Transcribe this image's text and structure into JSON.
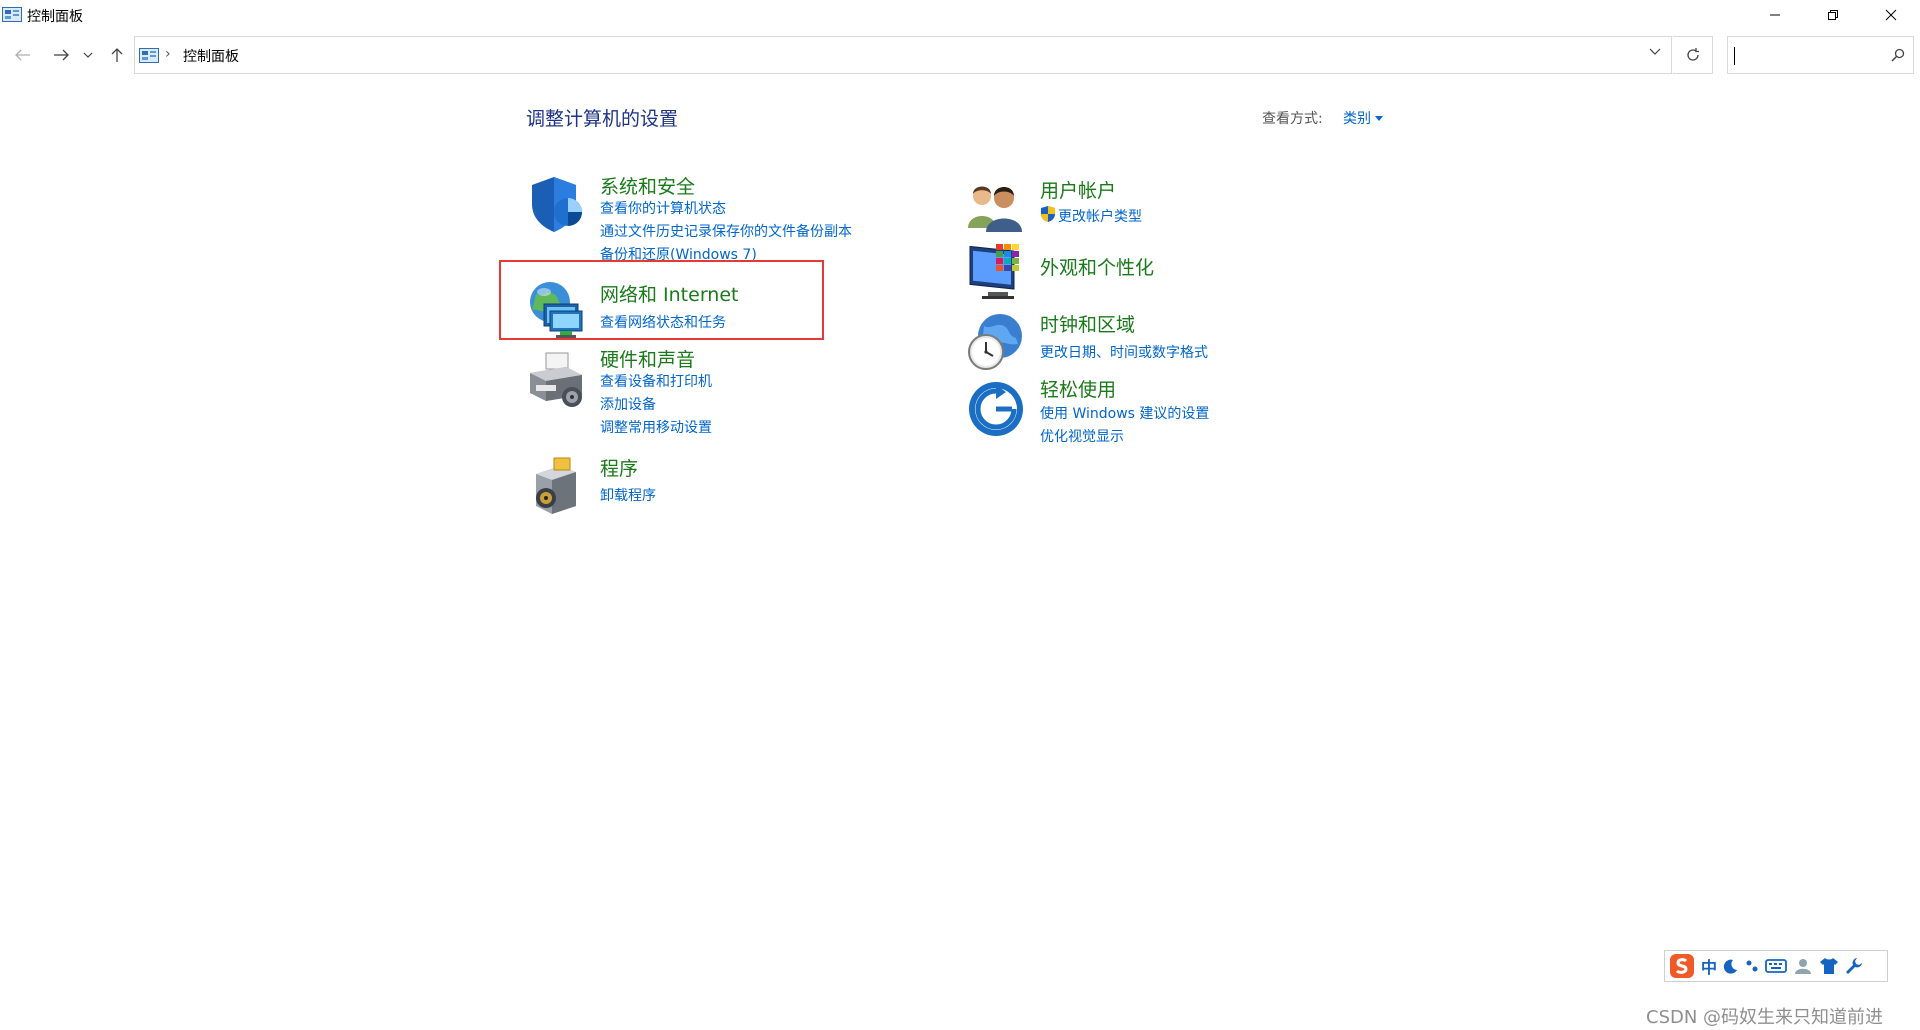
{
  "window": {
    "title": "控制面板"
  },
  "address": {
    "crumb": "控制面板",
    "search_placeholder": ""
  },
  "content": {
    "heading": "调整计算机的设置",
    "view_by_label": "查看方式:",
    "view_by_value": "类别"
  },
  "categories_left": [
    {
      "title": "系统和安全",
      "icon": "shield-icon",
      "links": [
        "查看你的计算机状态",
        "通过文件历史记录保存你的文件备份副本",
        "备份和还原(Windows 7)"
      ]
    },
    {
      "title": "网络和 Internet",
      "icon": "network-globe-icon",
      "links": [
        "查看网络状态和任务"
      ]
    },
    {
      "title": "硬件和声音",
      "icon": "printer-icon",
      "links": [
        "查看设备和打印机",
        "添加设备",
        "调整常用移动设置"
      ]
    },
    {
      "title": "程序",
      "icon": "programs-box-icon",
      "links": [
        "卸载程序"
      ]
    }
  ],
  "categories_right": [
    {
      "title": "用户帐户",
      "icon": "users-icon",
      "links": [
        "更改帐户类型"
      ]
    },
    {
      "title": "外观和个性化",
      "icon": "monitor-palette-icon",
      "links": []
    },
    {
      "title": "时钟和区域",
      "icon": "clock-globe-icon",
      "links": [
        "更改日期、时间或数字格式"
      ]
    },
    {
      "title": "轻松使用",
      "icon": "ease-of-access-icon",
      "links": [
        "使用 Windows 建议的设置",
        "优化视觉显示"
      ]
    }
  ],
  "ime": {
    "mode": "中"
  },
  "watermark": "CSDN @码奴生来只知道前进"
}
